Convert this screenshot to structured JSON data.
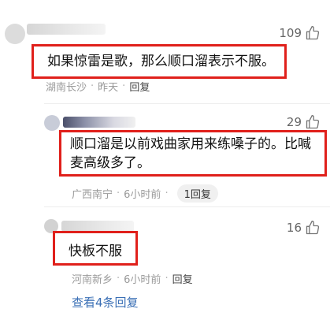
{
  "comments": [
    {
      "likes": "109",
      "text": "如果惊雷是歌，那么顺口溜表示不服。",
      "location": "湖南长沙",
      "time": "昨天",
      "reply_label": "回复"
    },
    {
      "likes": "29",
      "text": "顺口溜是以前戏曲家用来练嗓子的。比喊麦高级多了。",
      "location": "广西南宁",
      "time": "6小时前",
      "reply_label": "1回复"
    },
    {
      "likes": "16",
      "text": "快板不服",
      "location": "河南新乡",
      "time": "6小时前",
      "reply_label": "回复"
    }
  ],
  "view_more_label": "查看4条回复",
  "colors": {
    "highlight_box": "#e0201b",
    "link": "#3a6fb5",
    "meta_text": "#9a9a9a"
  },
  "icons": {
    "like": "thumbs-up-icon"
  }
}
